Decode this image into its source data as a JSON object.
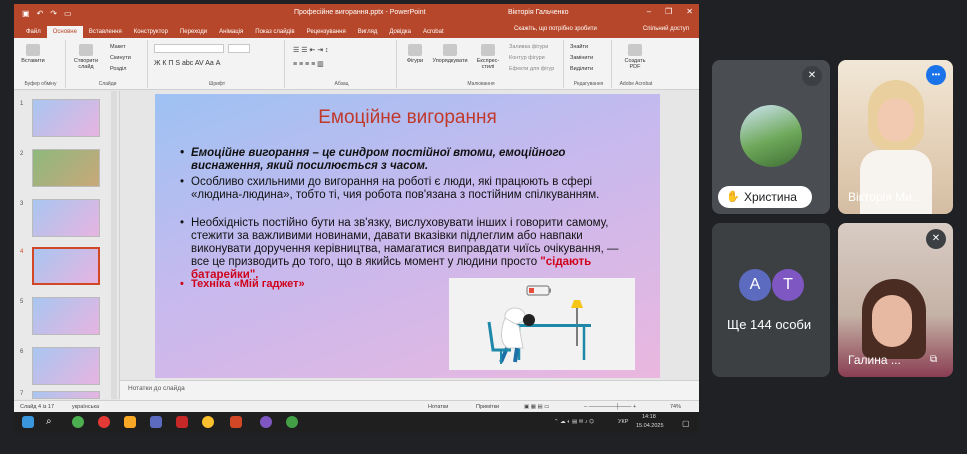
{
  "window": {
    "title": "Професійне вигорання.pptx  -  PowerPoint",
    "user": "Вікторія Гальченко",
    "buttons": [
      "–",
      "❐",
      "✕"
    ]
  },
  "ribbon": {
    "tabs": [
      "Файл",
      "Основне",
      "Вставлення",
      "Конструктор",
      "Переходи",
      "Анімація",
      "Показ слайдів",
      "Рецензування",
      "Вигляд",
      "Довідка",
      "Acrobat"
    ],
    "tell_me": "Скажіть, що потрібно зробити",
    "share": "Спільний доступ",
    "groups": {
      "clipboard": "Буфер обміну",
      "slides": "Слайди",
      "font": "Шрифт",
      "paragraph": "Абзац",
      "drawing": "Малювання",
      "editing": "Редагування",
      "acrobat": "Adobe Acrobat"
    },
    "buttons": {
      "paste": "Вставити",
      "new_slide": "Створити слайд",
      "layout": "Макет",
      "reset": "Скинути",
      "section": "Розділ",
      "shapes": "Фігури",
      "arrange": "Упорядкувати",
      "quick_styles": "Експрес-стилі",
      "shape_fill": "Заливка фігури",
      "shape_outline": "Контур фігури",
      "shape_effects": "Ефекти для фігур",
      "find": "Знайти",
      "replace": "Замінити",
      "select": "Виділити",
      "create_pdf": "Создать PDF"
    },
    "font_format_buttons": "Ж К П S abc AV Aa А"
  },
  "slides_panel": {
    "numbers": [
      "1",
      "2",
      "3",
      "4",
      "5",
      "6",
      "7"
    ],
    "active_index": 3
  },
  "slide": {
    "title": "Емоційне вигорання",
    "bullet1": "Емоційне вигорання – це синдром постійної втоми, емоційного виснаження, який посилюється з часом.",
    "bullet2": "Особливо схильними до вигорання на роботі є люди, які працюють в сфері «людина-людина», тобто ті, чия робота пов'язана з постійним спілкуванням.",
    "bullet3_main": "Необхідність постійно бути на зв'язку, вислуховувати інших і говорити самому, стежити за важливими новинами, давати вказівки підлеглим або навпаки виконувати доручення керівництва, намагатися виправдати чиїсь очікування, — все це призводить до того, що в якийсь момент у людини просто ",
    "bullet3_highlight": "\"сідають батарейки\".",
    "bullet4": "Техніка «Мій гаджет»"
  },
  "notes_placeholder": "Нотатки до слайда",
  "status": {
    "slide": "Слайд 4 із 17",
    "language": "українська",
    "notes": "Нотатки",
    "comments": "Примітки",
    "zoom": "74%"
  },
  "taskbar": {
    "language": "УКР",
    "time": "14:18",
    "date": "15.04.2025"
  },
  "meet": {
    "participants": [
      {
        "name": "Христина"
      },
      {
        "name": "Вікторія Ми..."
      },
      {
        "name": "Галина ..."
      }
    ],
    "more": {
      "label": "Ще 144 особи",
      "avatars": [
        "А",
        "Т"
      ]
    }
  },
  "colors": {
    "ppt_accent": "#b7472a",
    "slide_title": "#c0392b",
    "highlight": "#d0021b"
  }
}
